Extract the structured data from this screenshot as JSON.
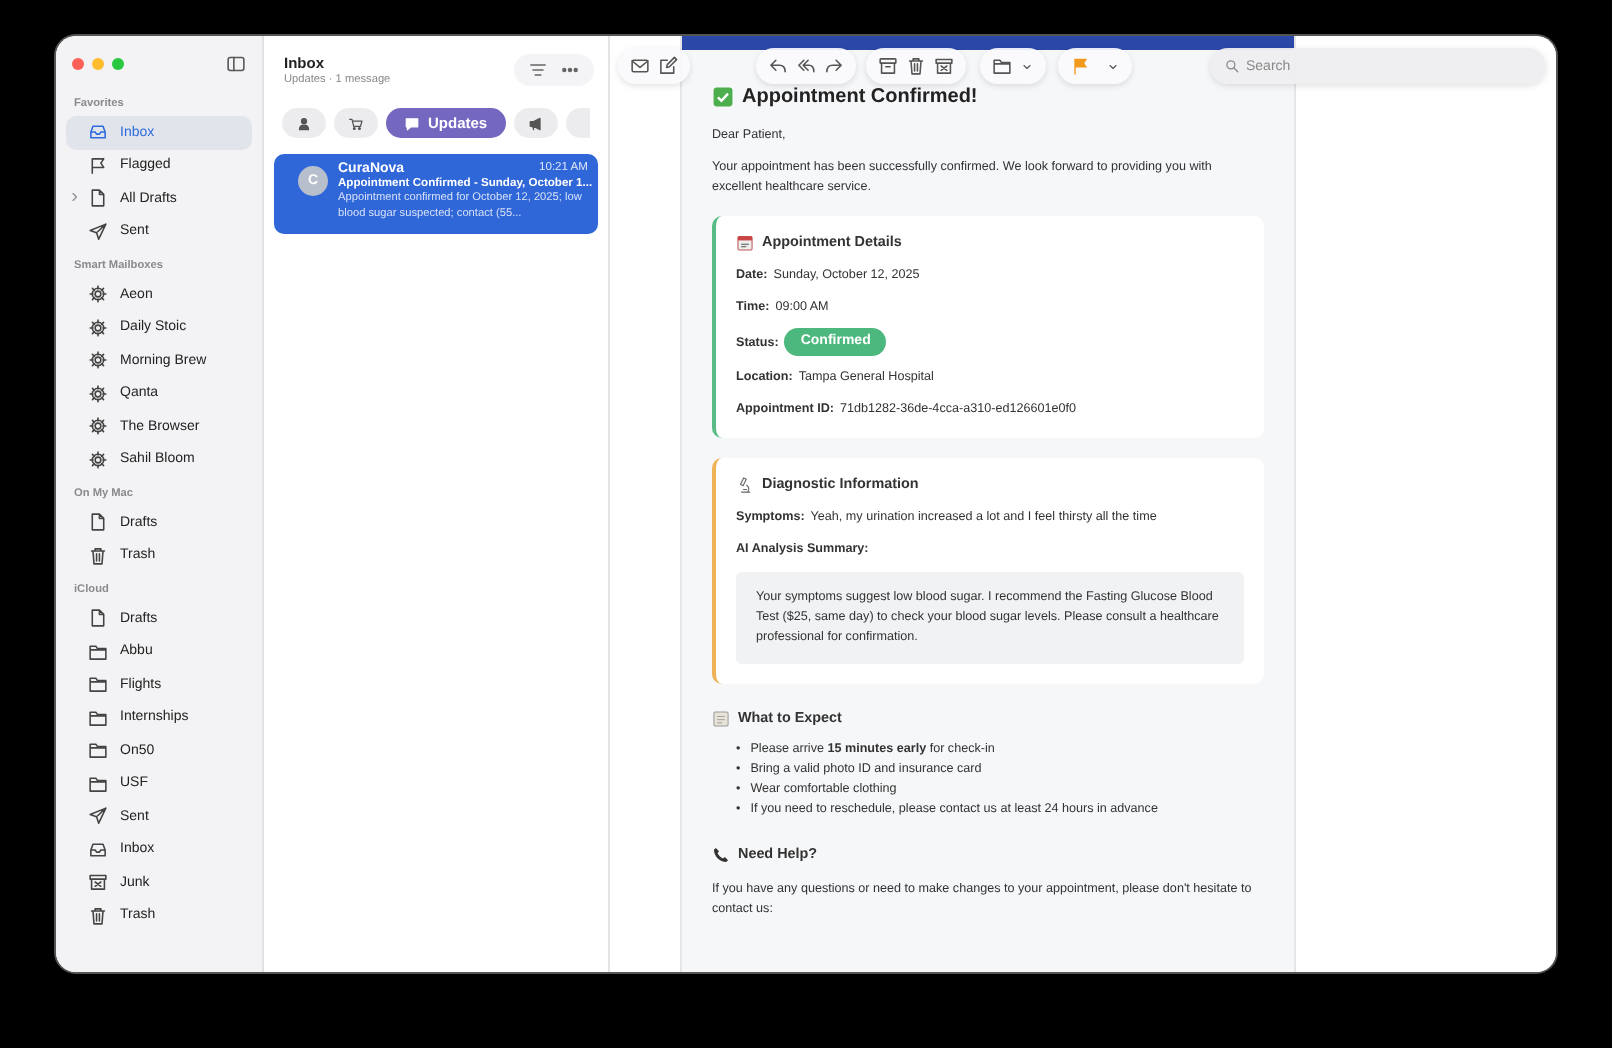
{
  "sidebar": {
    "sections": [
      {
        "title": "Favorites",
        "items": [
          {
            "label": "Inbox",
            "kind": "inbox",
            "selected": true
          },
          {
            "label": "Flagged",
            "kind": "flag",
            "selected": false
          },
          {
            "label": "All Drafts",
            "kind": "doc",
            "selected": false,
            "expanded": false
          },
          {
            "label": "Sent",
            "kind": "send",
            "selected": false
          }
        ]
      },
      {
        "title": "Smart Mailboxes",
        "items": [
          {
            "label": "Aeon",
            "kind": "gear",
            "selected": false
          },
          {
            "label": "Daily Stoic",
            "kind": "gear",
            "selected": false
          },
          {
            "label": "Morning Brew",
            "kind": "gear",
            "selected": false
          },
          {
            "label": "Qanta",
            "kind": "gear",
            "selected": false
          },
          {
            "label": "The Browser",
            "kind": "gear",
            "selected": false
          },
          {
            "label": "Sahil Bloom",
            "kind": "gear",
            "selected": false
          }
        ]
      },
      {
        "title": "On My Mac",
        "items": [
          {
            "label": "Drafts",
            "kind": "doc",
            "selected": false
          },
          {
            "label": "Trash",
            "kind": "trash",
            "selected": false
          }
        ]
      },
      {
        "title": "iCloud",
        "items": [
          {
            "label": "Drafts",
            "kind": "doc",
            "selected": false
          },
          {
            "label": "Abbu",
            "kind": "folder",
            "selected": false
          },
          {
            "label": "Flights",
            "kind": "folder",
            "selected": false
          },
          {
            "label": "Internships",
            "kind": "folder",
            "selected": false
          },
          {
            "label": "On50",
            "kind": "folder",
            "selected": false
          },
          {
            "label": "USF",
            "kind": "folder",
            "selected": false
          },
          {
            "label": "Sent",
            "kind": "send",
            "selected": false
          },
          {
            "label": "Inbox",
            "kind": "inbox",
            "selected": false
          },
          {
            "label": "Junk",
            "kind": "junk",
            "selected": false
          },
          {
            "label": "Trash",
            "kind": "trash",
            "selected": false
          }
        ]
      }
    ]
  },
  "message_list": {
    "title": "Inbox",
    "subtitle": "Updates · 1 message",
    "categories": [
      {
        "kind": "person",
        "selected": false
      },
      {
        "kind": "cart",
        "selected": false
      },
      {
        "kind": "chat",
        "label": "Updates",
        "selected": true
      },
      {
        "kind": "megaphone",
        "selected": false
      },
      {
        "kind": "blank",
        "selected": false
      }
    ],
    "messages": [
      {
        "avatar": "C",
        "sender": "CuraNova",
        "time": "10:21 AM",
        "subject": "Appointment Confirmed - Sunday, October 1...",
        "preview": "Appointment confirmed for October 12, 2025; low blood sugar suspected; contact (55...",
        "selected": true
      }
    ]
  },
  "toolbar": {
    "search": {
      "placeholder": "Search"
    }
  },
  "email": {
    "title": "Appointment Confirmed!",
    "greeting": "Dear Patient,",
    "intro": "Your appointment has been successfully confirmed. We look forward to providing you with excellent healthcare service.",
    "details": {
      "heading": "Appointment Details",
      "color": "#5bbb86",
      "fields": [
        {
          "label": "Date:",
          "value": "Sunday, October 12, 2025",
          "kind": "text"
        },
        {
          "label": "Time:",
          "value": "09:00 AM",
          "kind": "text"
        },
        {
          "label": "Status:",
          "value": "Confirmed",
          "kind": "badge"
        },
        {
          "label": "Location:",
          "value": "Tampa General Hospital",
          "kind": "text"
        },
        {
          "label": "Appointment ID:",
          "value": "71db1282-36de-4cca-a310-ed126601e0f0",
          "kind": "text"
        }
      ]
    },
    "diagnostic": {
      "heading": "Diagnostic Information",
      "color": "#efb256",
      "symptoms_label": "Symptoms:",
      "symptoms": "Yeah, my urination increased a lot and I feel thirsty all the time",
      "summary_label": "AI Analysis Summary:",
      "summary": "Your symptoms suggest low blood sugar. I recommend the Fasting Glucose Blood Test ($25, same day) to check your blood sugar levels. Please consult a healthcare professional for confirmation."
    },
    "expect": {
      "heading": "What to Expect",
      "bullet": "•",
      "items": [
        "Please arrive **15 minutes early** for check-in",
        "Bring a valid photo ID and insurance card",
        "Wear comfortable clothing",
        "If you need to reschedule, please contact us at least 24 hours in advance"
      ]
    },
    "help": {
      "heading": "Need Help?",
      "text": "If you have any questions or need to make changes to your appointment, please don't hesitate to contact us:"
    }
  }
}
